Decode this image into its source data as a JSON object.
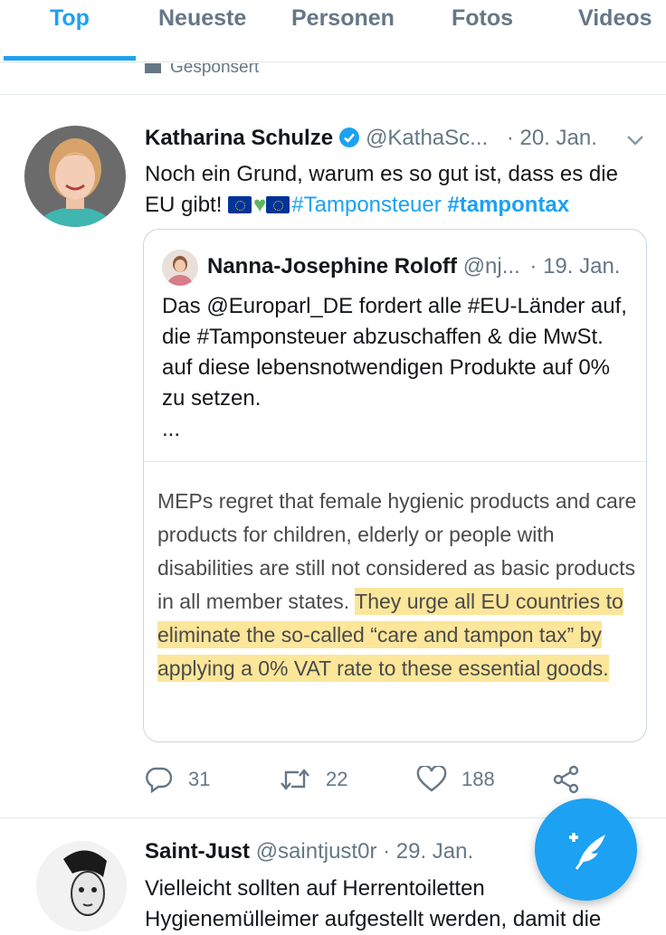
{
  "tabs": [
    {
      "label": "Top"
    },
    {
      "label": "Neueste"
    },
    {
      "label": "Personen"
    },
    {
      "label": "Fotos"
    },
    {
      "label": "Videos"
    }
  ],
  "sponsored_label": "Gesponsert",
  "tweet1": {
    "name": "Katharina Schulze",
    "handle": "@KathaSc...",
    "date": "· 20. Jan.",
    "text_plain": "Noch ein Grund, warum es so gut ist, dass es die EU gibt!",
    "hashtag1": "#Tamponsteuer",
    "hashtag2": "#tampontax",
    "quote": {
      "name": "Nanna-Josephine Roloff",
      "handle": "@nj...",
      "date": "· 19. Jan.",
      "text": "Das @Europarl_DE fordert alle #EU-Länder auf, die #Tamponsteuer abzuschaffen & die MwSt. auf diese lebensnotwendigen Produkte auf 0% zu setzen.",
      "ellipsis": "...",
      "image_text_plain": "MEPs regret that female hygienic products and care products for children, elderly or people with disabilities are still not considered as basic products in all member states. ",
      "image_text_highlight": "They urge all EU countries to eliminate the so-called “care and tampon tax” by applying a 0% VAT rate to these essential goods."
    },
    "replies": "31",
    "retweets": "22",
    "likes": "188"
  },
  "tweet2": {
    "name": "Saint-Just",
    "handle": "@saintjust0r",
    "date": "· 29. Jan.",
    "text": "Vielleicht sollten auf Herrentoiletten Hygienemülleimer aufgestellt werden, damit die"
  },
  "colors": {
    "accent": "#1da1f2",
    "muted": "#657786",
    "highlight": "#fade78"
  },
  "icons": {
    "verified": "verified-badge-icon",
    "reply": "reply-icon",
    "retweet": "retweet-icon",
    "like": "heart-icon",
    "share": "share-icon",
    "compose": "compose-tweet-icon"
  }
}
